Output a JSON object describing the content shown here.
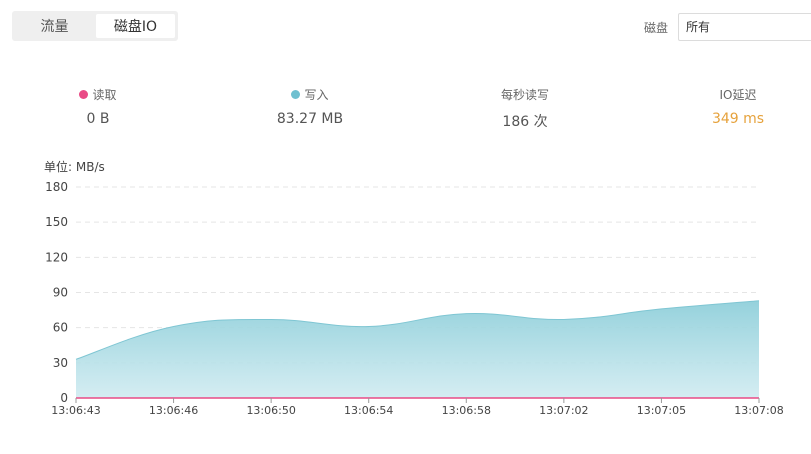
{
  "tabs": [
    {
      "label": "流量",
      "active": false
    },
    {
      "label": "磁盘IO",
      "active": true
    }
  ],
  "disk_filter": {
    "label": "磁盘",
    "selected": "所有"
  },
  "stats": {
    "read": {
      "label": "读取",
      "value": "0 B",
      "color": "#e94b86"
    },
    "write": {
      "label": "写入",
      "value": "83.27 MB",
      "color": "#6fc0d0"
    },
    "iops": {
      "label": "每秒读写",
      "value": "186 次"
    },
    "latency": {
      "label": "IO延迟",
      "value": "349 ms",
      "color": "#e6a23c"
    }
  },
  "chart_data": {
    "type": "area",
    "unit_label": "单位: MB/s",
    "ylim": [
      0,
      180
    ],
    "yticks": [
      "0",
      "30",
      "60",
      "90",
      "120",
      "150",
      "180"
    ],
    "x": [
      "13:06:43",
      "13:06:46",
      "13:06:50",
      "13:06:54",
      "13:06:58",
      "13:07:02",
      "13:07:05",
      "13:07:08"
    ],
    "grid": true,
    "series": [
      {
        "name": "读取",
        "color": "#e94b86",
        "values": [
          0,
          0,
          0,
          0,
          0,
          0,
          0,
          0
        ]
      },
      {
        "name": "写入",
        "color": "#6fc0d0",
        "values": [
          33,
          61,
          67,
          61,
          72,
          67,
          76,
          83
        ]
      }
    ]
  }
}
